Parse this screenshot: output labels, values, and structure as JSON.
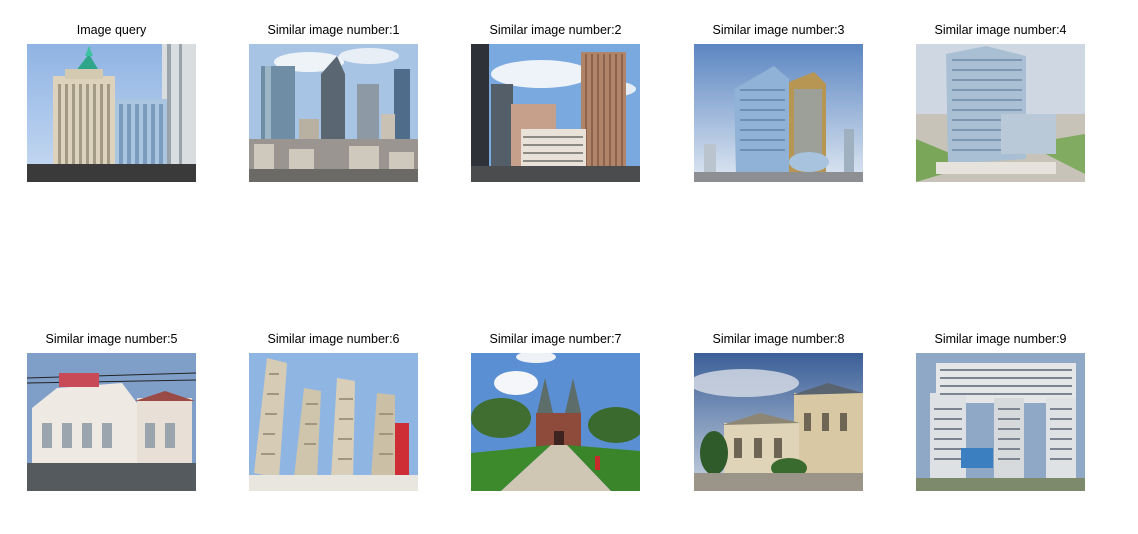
{
  "figure": {
    "captions": [
      "Image query",
      "Similar image number:1",
      "Similar image number:2",
      "Similar image number:3",
      "Similar image number:4",
      "Similar image number:5",
      "Similar image number:6",
      "Similar image number:7",
      "Similar image number:8",
      "Similar image number:9"
    ]
  }
}
